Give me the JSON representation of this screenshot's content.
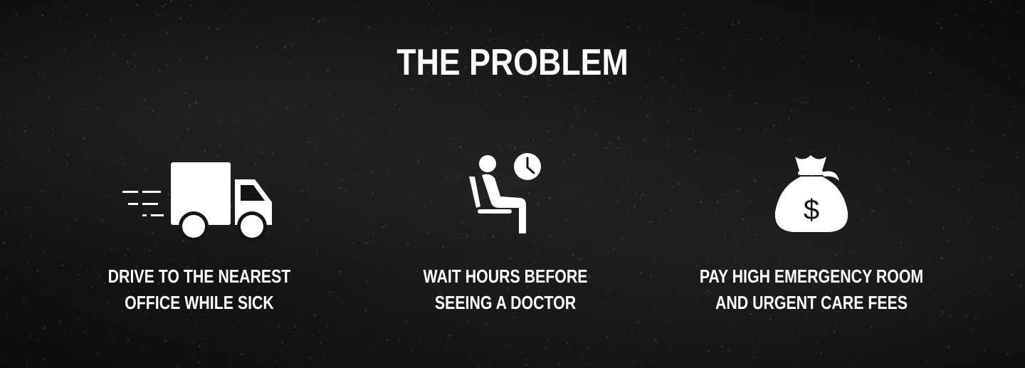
{
  "section": {
    "title": "THE PROBLEM"
  },
  "problems": [
    {
      "icon": "delivery-truck-icon",
      "line1": "DRIVE TO THE NEAREST",
      "line2": "OFFICE WHILE SICK"
    },
    {
      "icon": "waiting-room-clock-icon",
      "line1": "WAIT HOURS BEFORE",
      "line2": "SEEING A DOCTOR"
    },
    {
      "icon": "money-bag-icon",
      "line1": "PAY HIGH EMERGENCY ROOM",
      "line2": "AND URGENT CARE FEES"
    }
  ],
  "colors": {
    "background": "#141414",
    "text": "#ffffff"
  }
}
